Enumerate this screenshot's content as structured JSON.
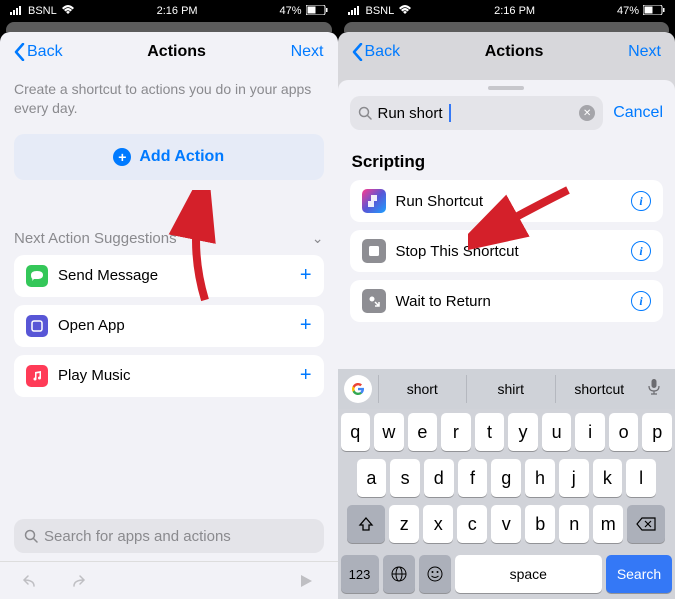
{
  "status": {
    "carrier": "BSNL",
    "time": "2:16 PM",
    "battery": "47%"
  },
  "left": {
    "nav": {
      "back": "Back",
      "title": "Actions",
      "next": "Next"
    },
    "description": "Create a shortcut to actions you do in your apps every day.",
    "add_action": "Add Action",
    "suggestions_header": "Next Action Suggestions",
    "suggestions": [
      {
        "label": "Send Message",
        "icon": "message",
        "color": "#34c759"
      },
      {
        "label": "Open App",
        "icon": "open-app",
        "color": "#5856d6"
      },
      {
        "label": "Play Music",
        "icon": "music",
        "color": "#ff3b57"
      }
    ],
    "search_placeholder": "Search for apps and actions"
  },
  "right": {
    "nav": {
      "back": "Back",
      "title": "Actions",
      "next": "Next"
    },
    "search_value": "Run short",
    "cancel": "Cancel",
    "section": "Scripting",
    "results": [
      {
        "label": "Run Shortcut",
        "icon": "shortcuts-app",
        "gradient": true
      },
      {
        "label": "Stop This Shortcut",
        "icon": "stop",
        "color": "#8e8e93"
      },
      {
        "label": "Wait to Return",
        "icon": "wait",
        "color": "#8e8e93"
      }
    ],
    "keyboard": {
      "suggestions": [
        "short",
        "shirt",
        "shortcut"
      ],
      "row1": [
        "q",
        "w",
        "e",
        "r",
        "t",
        "y",
        "u",
        "i",
        "o",
        "p"
      ],
      "row2": [
        "a",
        "s",
        "d",
        "f",
        "g",
        "h",
        "j",
        "k",
        "l"
      ],
      "row3": [
        "z",
        "x",
        "c",
        "v",
        "b",
        "n",
        "m"
      ],
      "n123": "123",
      "space": "space",
      "search": "Search"
    }
  }
}
